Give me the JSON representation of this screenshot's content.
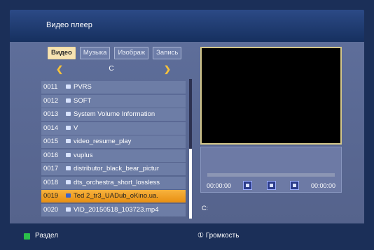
{
  "header": {
    "title": "Видео плеер"
  },
  "tabs": [
    {
      "label": "Видео",
      "active": true
    },
    {
      "label": "Музыка",
      "active": false
    },
    {
      "label": "Изображ",
      "active": false
    },
    {
      "label": "Запись",
      "active": false
    }
  ],
  "path_nav": {
    "current": "C",
    "prev_icon": "chevron-left-icon",
    "next_icon": "chevron-right-icon"
  },
  "files": [
    {
      "num": "0011",
      "name": "PVRS",
      "type": "folder"
    },
    {
      "num": "0012",
      "name": "SOFT",
      "type": "folder"
    },
    {
      "num": "0013",
      "name": "System Volume Information",
      "type": "folder"
    },
    {
      "num": "0014",
      "name": "V",
      "type": "folder"
    },
    {
      "num": "0015",
      "name": "video_resume_play",
      "type": "folder"
    },
    {
      "num": "0016",
      "name": "vuplus",
      "type": "folder"
    },
    {
      "num": "0017",
      "name": "distributor_black_bear_pictur",
      "type": "video"
    },
    {
      "num": "0018",
      "name": "dts_orchestra_short_lossless",
      "type": "video"
    },
    {
      "num": "0019",
      "name": "Ted 2_tr3_UADub_oKino.ua.",
      "type": "video",
      "selected": true
    },
    {
      "num": "0020",
      "name": "VID_20150518_103723.mp4",
      "type": "video"
    }
  ],
  "player": {
    "time_current": "00:00:00",
    "time_total": "00:00:00",
    "progress": 0,
    "path_label": "C:"
  },
  "footer": {
    "section_label": "Раздел",
    "volume_label": "① Громкость"
  },
  "colors": {
    "accent": "#f5c23b",
    "selected_row": "#f0a02a",
    "green_key": "#2bc04a",
    "preview_border": "#d5c88a"
  }
}
